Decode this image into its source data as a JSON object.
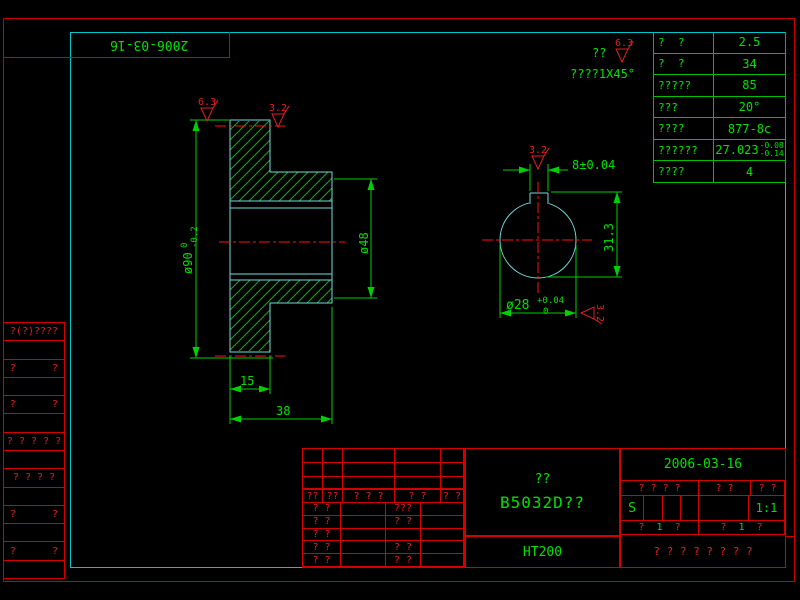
{
  "colors": {
    "red": "#d40000",
    "green": "#00e000",
    "cyan": "#00c8c8",
    "outline": "#6fdcdc",
    "background": "#000000"
  },
  "stamp": {
    "date": "2006-03-16"
  },
  "finish_note": {
    "prefix": "??",
    "grade": "6.3",
    "detail": "????1X45°"
  },
  "param_table": {
    "rows": [
      {
        "label": "?  ?",
        "value": "2.5"
      },
      {
        "label": "?  ?",
        "value": "34"
      },
      {
        "label": "?????",
        "value": "85"
      },
      {
        "label": "???",
        "value": "20°"
      },
      {
        "label": "????",
        "value": "877-8c"
      },
      {
        "label": "??????",
        "value": "27.023",
        "tol_up": "-0.08",
        "tol_dn": "-0.14"
      },
      {
        "label": "????",
        "value": "4"
      }
    ]
  },
  "left_strip": {
    "rows": [
      "?(?)????",
      "",
      "?      ?",
      "",
      "?      ?",
      "",
      "? ? ? ? ?",
      "",
      "? ? ? ?",
      "",
      "?      ?",
      "",
      "?      ?",
      ""
    ]
  },
  "section_view": {
    "dia90": {
      "text": "ø90",
      "tol_up": "0",
      "tol_dn": "-0.2"
    },
    "dia48": "ø48",
    "len15": "15",
    "len38": "38",
    "finish_left": "6.3",
    "finish_right": "3.2"
  },
  "end_view": {
    "slot_width": "8±0.04",
    "slot_depth": "31.3",
    "bore": {
      "text": "ø28",
      "tol_up": "+0.04",
      "tol_dn": "0"
    },
    "finish_top": "3.2",
    "finish_side": "3.2"
  },
  "title_block": {
    "left": {
      "header": [
        "??",
        "??",
        "? ? ?",
        "? ?",
        "? ?"
      ],
      "rows": [
        [
          "? ?",
          "",
          "???",
          ""
        ],
        [
          "? ?",
          "",
          "? ?",
          ""
        ],
        [
          "? ?",
          "",
          "",
          ""
        ],
        [
          "? ?",
          "",
          "? ?",
          ""
        ],
        [
          "? ?",
          "",
          "? ?",
          ""
        ]
      ]
    },
    "middle": {
      "subtitle": "??",
      "drawing_no": "B5032D??",
      "material": "HT200"
    },
    "right": {
      "date": "2006-03-16",
      "labels": [
        "? ? ? ?",
        "? ?",
        "? ?"
      ],
      "s_label": "S",
      "scale": "1:1",
      "sheet_left": {
        "a": "?",
        "b": "1",
        "c": "?"
      },
      "sheet_right": {
        "a": "?",
        "b": "1",
        "c": "?"
      },
      "bottom": "? ? ? ? ? ? ? ?"
    }
  }
}
